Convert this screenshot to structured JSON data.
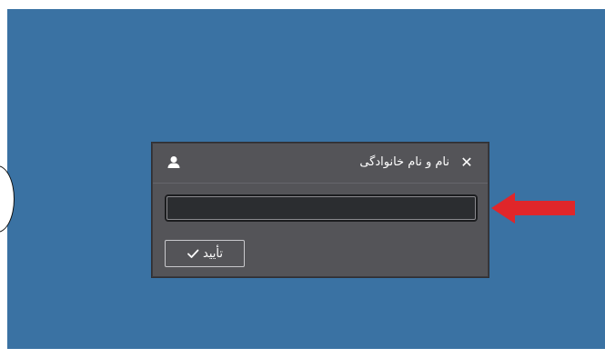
{
  "dialog": {
    "title": "نام و نام خانوادگی",
    "close_icon": "close-icon",
    "user_icon": "user-icon",
    "input": {
      "value": "",
      "placeholder": ""
    },
    "confirm_label": "تأیید",
    "confirm_icon": "check-icon"
  },
  "annotation": {
    "arrow_icon": "red-arrow-icon",
    "arrow_color": "#e0262a"
  },
  "colors": {
    "background": "#3a72a3",
    "dialog": "#545458",
    "input": "#2b2d30"
  }
}
